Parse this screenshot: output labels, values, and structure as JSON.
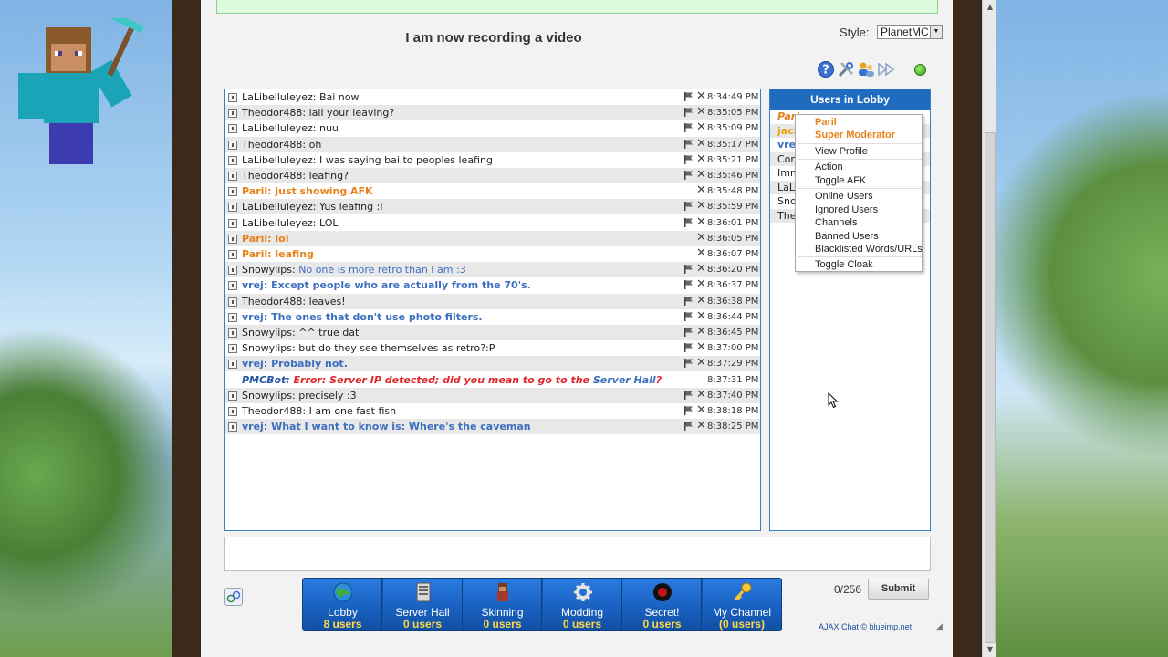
{
  "page": {
    "title": "I am now recording a video",
    "style_label": "Style:",
    "style_value": "PlanetMC"
  },
  "toolbar": {
    "icons": [
      "help-icon",
      "settings-icon",
      "users-icon",
      "fast-forward-icon"
    ],
    "status_color": "#2f9a14"
  },
  "messages": [
    {
      "name": "LaLibelluleyez",
      "role": "user",
      "text": "Bai now",
      "time": "8:34:49 PM",
      "flag": true
    },
    {
      "name": "Theodor488",
      "role": "user",
      "text": "lali your leaving?",
      "time": "8:35:05 PM",
      "flag": true
    },
    {
      "name": "LaLibelluleyez",
      "role": "user",
      "text": "nuu",
      "time": "8:35:09 PM",
      "flag": true
    },
    {
      "name": "Theodor488",
      "role": "user",
      "text": "oh",
      "time": "8:35:17 PM",
      "flag": true
    },
    {
      "name": "LaLibelluleyez",
      "role": "user",
      "text": "I was saying bai to peoples leafing",
      "time": "8:35:21 PM",
      "flag": true
    },
    {
      "name": "Theodor488",
      "role": "user",
      "text": "leafing?",
      "time": "8:35:46 PM",
      "flag": true
    },
    {
      "name": "Paril",
      "role": "mod",
      "text": "just showing AFK",
      "time": "8:35:48 PM",
      "flag": false
    },
    {
      "name": "LaLibelluleyez",
      "role": "user",
      "text": "Yus leafing :I",
      "time": "8:35:59 PM",
      "flag": true
    },
    {
      "name": "LaLibelluleyez",
      "role": "user",
      "text": "LOL",
      "time": "8:36:01 PM",
      "flag": true
    },
    {
      "name": "Paril",
      "role": "mod",
      "text": "lol",
      "time": "8:36:05 PM",
      "flag": false
    },
    {
      "name": "Paril",
      "role": "mod",
      "text": "leafing",
      "time": "8:36:07 PM",
      "flag": false
    },
    {
      "name": "Snowylips",
      "role": "user",
      "text": "No one is more retro than I am :3",
      "text_style": "blue",
      "time": "8:36:20 PM",
      "flag": true
    },
    {
      "name": "vrej",
      "role": "blue",
      "text": "Except people who are actually from the 70's.",
      "time": "8:36:37 PM",
      "flag": true
    },
    {
      "name": "Theodor488",
      "role": "user",
      "text": "leaves!",
      "time": "8:36:38 PM",
      "flag": true
    },
    {
      "name": "vrej",
      "role": "blue",
      "text": "The ones that don't use photo filters.",
      "time": "8:36:44 PM",
      "flag": true
    },
    {
      "name": "Snowylips",
      "role": "user",
      "text": "^^ true dat",
      "time": "8:36:45 PM",
      "flag": true
    },
    {
      "name": "Snowylips",
      "role": "user",
      "text": "but do they see themselves as retro?:P",
      "time": "8:37:00 PM",
      "flag": true
    },
    {
      "name": "vrej",
      "role": "blue",
      "text": "Probably not.",
      "time": "8:37:29 PM",
      "flag": true
    },
    {
      "name": "PMCBot",
      "role": "bot",
      "text": "Error: Server IP detected; did you mean to go to the ",
      "link": "Server Hall",
      "text_end": "?",
      "time": "8:37:31 PM",
      "flag": false
    },
    {
      "name": "Snowylips",
      "role": "user",
      "text": "precisely :3",
      "time": "8:37:40 PM",
      "flag": true
    },
    {
      "name": "Theodor488",
      "role": "user",
      "text": "I am one fast fish",
      "time": "8:38:18 PM",
      "flag": true
    },
    {
      "name": "vrej",
      "role": "blue",
      "text": "What I want to know is: Where's the caveman",
      "time": "8:38:25 PM",
      "flag": true
    }
  ],
  "users_panel": {
    "title": "Users in Lobby",
    "users": [
      {
        "label": "Pari",
        "style": "mod"
      },
      {
        "label": "jack",
        "style": "gold"
      },
      {
        "label": "vrej",
        "style": "blue"
      },
      {
        "label": "Cor",
        "style": "user"
      },
      {
        "label": "Imm",
        "style": "user"
      },
      {
        "label": "LaL",
        "style": "user"
      },
      {
        "label": "Sno",
        "style": "user"
      },
      {
        "label": "The",
        "style": "user"
      }
    ]
  },
  "context_menu": {
    "user": "Paril",
    "role": "Super Moderator",
    "items": [
      "View Profile",
      "Action",
      "Toggle AFK",
      "Online Users",
      "Ignored Users",
      "Channels",
      "Banned Users",
      "Blacklisted Words/URLs",
      "Toggle Cloak"
    ]
  },
  "channels": [
    {
      "name": "Lobby",
      "users": "8 users",
      "icon": "globe-icon"
    },
    {
      "name": "Server Hall",
      "users": "0 users",
      "icon": "server-icon"
    },
    {
      "name": "Skinning",
      "users": "0 users",
      "icon": "skin-icon"
    },
    {
      "name": "Modding",
      "users": "0 users",
      "icon": "gear-icon"
    },
    {
      "name": "Secret!",
      "users": "0 users",
      "icon": "secret-icon"
    },
    {
      "name": "My Channel",
      "users": "(0 users)",
      "icon": "key-icon"
    }
  ],
  "composer": {
    "counter": "0/256",
    "submit_label": "Submit"
  },
  "credit": "AJAX Chat © blueimp.net",
  "colors": {
    "accent": "#1f6bc0",
    "moderator": "#e7821a",
    "link": "#3d6fc0",
    "error": "#e0262a",
    "channel_count": "#ffd84a"
  }
}
